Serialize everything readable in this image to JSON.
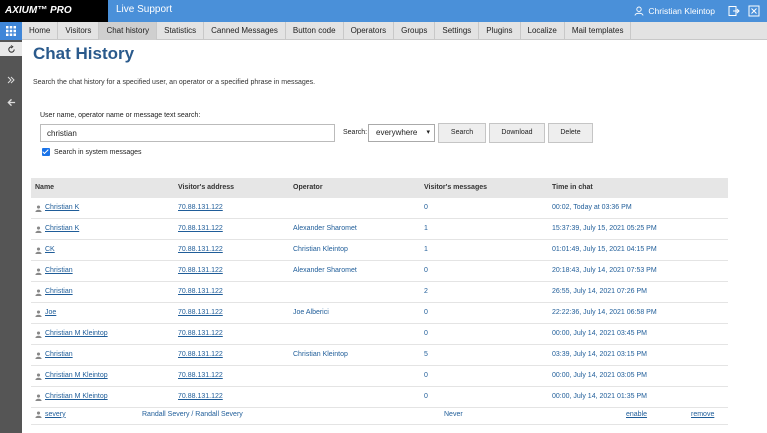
{
  "topbar": {
    "logo": "AXIUM™ PRO",
    "product": "Live Support",
    "user_name": "Christian Kleintop",
    "icons": [
      "user-icon",
      "logout-icon",
      "close-window-icon"
    ]
  },
  "nav": {
    "tabs": [
      {
        "label": "Home"
      },
      {
        "label": "Visitors"
      },
      {
        "label": "Chat history",
        "active": true
      },
      {
        "label": "Statistics"
      },
      {
        "label": "Canned Messages"
      },
      {
        "label": "Button code"
      },
      {
        "label": "Operators"
      },
      {
        "label": "Groups"
      },
      {
        "label": "Settings"
      },
      {
        "label": "Plugins"
      },
      {
        "label": "Localize"
      },
      {
        "label": "Mail templates"
      }
    ]
  },
  "page": {
    "title": "Chat History",
    "description": "Search the chat history for a specified user, an operator or a specified phrase in messages."
  },
  "search": {
    "label": "User name, operator name or message text search:",
    "value": "christian",
    "in_label": "Search:",
    "scope_selected": "everywhere",
    "search_btn": "Search",
    "download_btn": "Download",
    "delete_btn": "Delete",
    "system_messages_label": "Search in system messages",
    "system_messages_checked": true
  },
  "table": {
    "headers": [
      "Name",
      "Visitor's address",
      "Operator",
      "Visitor's messages",
      "Time in chat"
    ],
    "rows": [
      {
        "name": "Christian K",
        "address": "70.88.131.122",
        "operator": "",
        "messages": "0",
        "time": "00:02, Today at 03:36 PM"
      },
      {
        "name": "Christian K",
        "address": "70.88.131.122",
        "operator": "Alexander Sharomet",
        "messages": "1",
        "time": "15:37:39, July 15, 2021 05:25 PM"
      },
      {
        "name": "CK",
        "address": "70.88.131.122",
        "operator": "Christian Kleintop",
        "messages": "1",
        "time": "01:01:49, July 15, 2021 04:15 PM"
      },
      {
        "name": "Christian",
        "address": "70.88.131.122",
        "operator": "Alexander Sharomet",
        "messages": "0",
        "time": "20:18:43, July 14, 2021 07:53 PM"
      },
      {
        "name": "Christian",
        "address": "70.88.131.122",
        "operator": "",
        "messages": "2",
        "time": "26:55, July 14, 2021 07:26 PM"
      },
      {
        "name": "Joe",
        "address": "70.88.131.122",
        "operator": "Joe Alberici",
        "messages": "0",
        "time": "22:22:36, July 14, 2021 06:58 PM"
      },
      {
        "name": "Christian M Kleintop",
        "address": "70.88.131.122",
        "operator": "",
        "messages": "0",
        "time": "00:00, July 14, 2021 03:45 PM"
      },
      {
        "name": "Christian",
        "address": "70.88.131.122",
        "operator": "Christian Kleintop",
        "messages": "5",
        "time": "03:39, July 14, 2021 03:15 PM"
      },
      {
        "name": "Christian M Kleintop",
        "address": "70.88.131.122",
        "operator": "",
        "messages": "0",
        "time": "00:00, July 14, 2021 03:05 PM"
      },
      {
        "name": "Christian M Kleintop",
        "address": "70.88.131.122",
        "operator": "",
        "messages": "0",
        "time": "00:00, July 14, 2021 01:35 PM"
      }
    ]
  },
  "footer_row": {
    "login": "severy",
    "full_name": "Randall Severy / Randall Severy",
    "last_seen": "Never",
    "enable": "enable",
    "remove": "remove"
  }
}
